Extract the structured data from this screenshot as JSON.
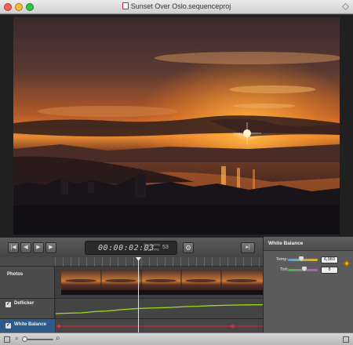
{
  "window": {
    "title": "Sunset Over Oslo.sequenceproj"
  },
  "toolbar": {
    "timecode": "00:00:02:03",
    "fps_line1": "30.00 FPS",
    "fps_line2": "at 12 FPS",
    "frame": "53",
    "buttons": [
      "go-to-start",
      "step-back",
      "play",
      "step-forward"
    ]
  },
  "tracks": [
    {
      "label": "Photos",
      "has_checkbox": false
    },
    {
      "label": "Deflicker",
      "has_checkbox": true,
      "checked": true
    },
    {
      "label": "White Balance",
      "has_checkbox": true,
      "checked": true
    }
  ],
  "inspector": {
    "title": "White Balance",
    "params": [
      {
        "label": "Temp:",
        "value": "6,983",
        "color_from": "#5aa0e0",
        "color_to": "#f0b020",
        "level": 0.45
      },
      {
        "label": "Tint:",
        "value": "8",
        "color_from": "#40c040",
        "color_to": "#c050d0",
        "level": 0.55
      }
    ]
  },
  "colors": {
    "accent_track": "#2c5a8c",
    "deflicker_curve": "#9fdc16",
    "wb_line": "#c8283c",
    "keyframe": "#f2a20a"
  },
  "deflicker_curve": [
    0.15,
    0.18,
    0.2,
    0.28,
    0.32,
    0.4,
    0.46,
    0.5,
    0.52,
    0.55,
    0.6,
    0.62,
    0.66,
    0.68,
    0.7,
    0.71,
    0.72
  ]
}
